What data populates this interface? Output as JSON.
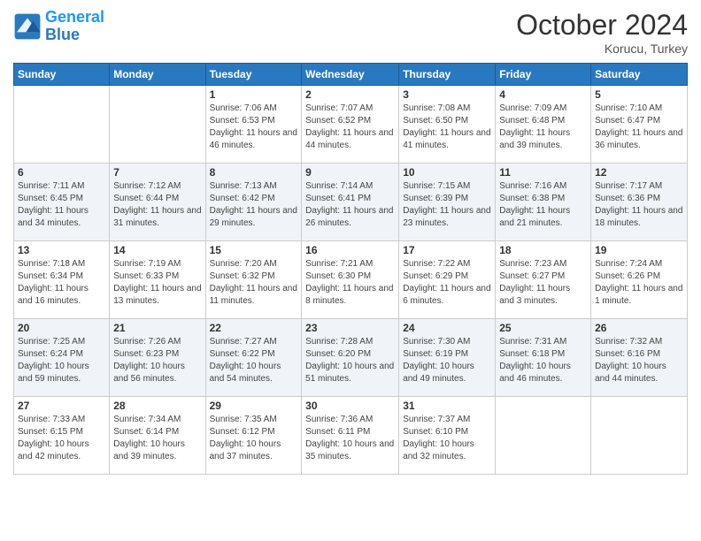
{
  "logo": {
    "line1": "General",
    "line2": "Blue"
  },
  "header": {
    "month": "October 2024",
    "location": "Korucu, Turkey"
  },
  "weekdays": [
    "Sunday",
    "Monday",
    "Tuesday",
    "Wednesday",
    "Thursday",
    "Friday",
    "Saturday"
  ],
  "weeks": [
    [
      {
        "day": "",
        "info": ""
      },
      {
        "day": "",
        "info": ""
      },
      {
        "day": "1",
        "info": "Sunrise: 7:06 AM\nSunset: 6:53 PM\nDaylight: 11 hours and 46 minutes."
      },
      {
        "day": "2",
        "info": "Sunrise: 7:07 AM\nSunset: 6:52 PM\nDaylight: 11 hours and 44 minutes."
      },
      {
        "day": "3",
        "info": "Sunrise: 7:08 AM\nSunset: 6:50 PM\nDaylight: 11 hours and 41 minutes."
      },
      {
        "day": "4",
        "info": "Sunrise: 7:09 AM\nSunset: 6:48 PM\nDaylight: 11 hours and 39 minutes."
      },
      {
        "day": "5",
        "info": "Sunrise: 7:10 AM\nSunset: 6:47 PM\nDaylight: 11 hours and 36 minutes."
      }
    ],
    [
      {
        "day": "6",
        "info": "Sunrise: 7:11 AM\nSunset: 6:45 PM\nDaylight: 11 hours and 34 minutes."
      },
      {
        "day": "7",
        "info": "Sunrise: 7:12 AM\nSunset: 6:44 PM\nDaylight: 11 hours and 31 minutes."
      },
      {
        "day": "8",
        "info": "Sunrise: 7:13 AM\nSunset: 6:42 PM\nDaylight: 11 hours and 29 minutes."
      },
      {
        "day": "9",
        "info": "Sunrise: 7:14 AM\nSunset: 6:41 PM\nDaylight: 11 hours and 26 minutes."
      },
      {
        "day": "10",
        "info": "Sunrise: 7:15 AM\nSunset: 6:39 PM\nDaylight: 11 hours and 23 minutes."
      },
      {
        "day": "11",
        "info": "Sunrise: 7:16 AM\nSunset: 6:38 PM\nDaylight: 11 hours and 21 minutes."
      },
      {
        "day": "12",
        "info": "Sunrise: 7:17 AM\nSunset: 6:36 PM\nDaylight: 11 hours and 18 minutes."
      }
    ],
    [
      {
        "day": "13",
        "info": "Sunrise: 7:18 AM\nSunset: 6:34 PM\nDaylight: 11 hours and 16 minutes."
      },
      {
        "day": "14",
        "info": "Sunrise: 7:19 AM\nSunset: 6:33 PM\nDaylight: 11 hours and 13 minutes."
      },
      {
        "day": "15",
        "info": "Sunrise: 7:20 AM\nSunset: 6:32 PM\nDaylight: 11 hours and 11 minutes."
      },
      {
        "day": "16",
        "info": "Sunrise: 7:21 AM\nSunset: 6:30 PM\nDaylight: 11 hours and 8 minutes."
      },
      {
        "day": "17",
        "info": "Sunrise: 7:22 AM\nSunset: 6:29 PM\nDaylight: 11 hours and 6 minutes."
      },
      {
        "day": "18",
        "info": "Sunrise: 7:23 AM\nSunset: 6:27 PM\nDaylight: 11 hours and 3 minutes."
      },
      {
        "day": "19",
        "info": "Sunrise: 7:24 AM\nSunset: 6:26 PM\nDaylight: 11 hours and 1 minute."
      }
    ],
    [
      {
        "day": "20",
        "info": "Sunrise: 7:25 AM\nSunset: 6:24 PM\nDaylight: 10 hours and 59 minutes."
      },
      {
        "day": "21",
        "info": "Sunrise: 7:26 AM\nSunset: 6:23 PM\nDaylight: 10 hours and 56 minutes."
      },
      {
        "day": "22",
        "info": "Sunrise: 7:27 AM\nSunset: 6:22 PM\nDaylight: 10 hours and 54 minutes."
      },
      {
        "day": "23",
        "info": "Sunrise: 7:28 AM\nSunset: 6:20 PM\nDaylight: 10 hours and 51 minutes."
      },
      {
        "day": "24",
        "info": "Sunrise: 7:30 AM\nSunset: 6:19 PM\nDaylight: 10 hours and 49 minutes."
      },
      {
        "day": "25",
        "info": "Sunrise: 7:31 AM\nSunset: 6:18 PM\nDaylight: 10 hours and 46 minutes."
      },
      {
        "day": "26",
        "info": "Sunrise: 7:32 AM\nSunset: 6:16 PM\nDaylight: 10 hours and 44 minutes."
      }
    ],
    [
      {
        "day": "27",
        "info": "Sunrise: 7:33 AM\nSunset: 6:15 PM\nDaylight: 10 hours and 42 minutes."
      },
      {
        "day": "28",
        "info": "Sunrise: 7:34 AM\nSunset: 6:14 PM\nDaylight: 10 hours and 39 minutes."
      },
      {
        "day": "29",
        "info": "Sunrise: 7:35 AM\nSunset: 6:12 PM\nDaylight: 10 hours and 37 minutes."
      },
      {
        "day": "30",
        "info": "Sunrise: 7:36 AM\nSunset: 6:11 PM\nDaylight: 10 hours and 35 minutes."
      },
      {
        "day": "31",
        "info": "Sunrise: 7:37 AM\nSunset: 6:10 PM\nDaylight: 10 hours and 32 minutes."
      },
      {
        "day": "",
        "info": ""
      },
      {
        "day": "",
        "info": ""
      }
    ]
  ]
}
